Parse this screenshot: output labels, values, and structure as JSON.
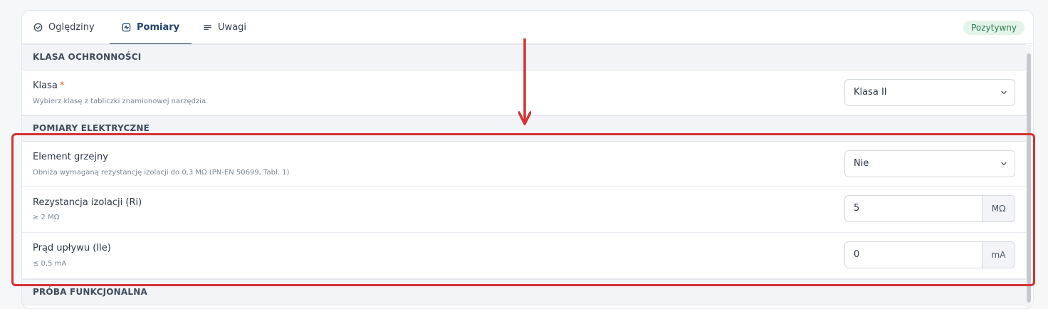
{
  "tabs": [
    {
      "label": "Oględziny",
      "icon": "check-circle-icon"
    },
    {
      "label": "Pomiary",
      "icon": "activity-icon",
      "active": true
    },
    {
      "label": "Uwagi",
      "icon": "lines-icon"
    }
  ],
  "status_badge": "Pozytywny",
  "sections": {
    "protection": {
      "title": "KLASA OCHRONNOŚCI",
      "klasa": {
        "label": "Klasa",
        "required_mark": "*",
        "hint": "Wybierz klasę z tabliczki znamionowej narzędzia.",
        "value": "Klasa II"
      }
    },
    "electrical": {
      "title": "POMIARY ELEKTRYCZNE",
      "heating": {
        "label": "Element grzejny",
        "hint": "Obniża wymaganą rezystancję izolacji do 0,3 MΩ (PN-EN 50699, Tabl. 1)",
        "value": "Nie"
      },
      "insulation": {
        "label": "Rezystancja izolacji (Ri)",
        "hint": "≥ 2 MΩ",
        "value": "5",
        "unit": "MΩ"
      },
      "leakage": {
        "label": "Prąd upływu (Ile)",
        "hint": "≤ 0,5 mA",
        "value": "0",
        "unit": "mA"
      }
    },
    "functional": {
      "title": "PRÓBA FUNKCJONALNA"
    }
  },
  "colors": {
    "accent": "#24446b",
    "badge_bg": "#e3f4ea",
    "badge_text": "#2c7a4f",
    "annotation": "#d63232"
  }
}
